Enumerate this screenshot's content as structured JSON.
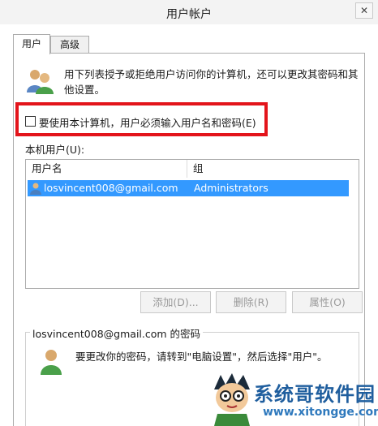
{
  "window": {
    "title": "用户帐户",
    "close_glyph": "✕"
  },
  "tabs": [
    {
      "label": "用户",
      "active": true
    },
    {
      "label": "高级",
      "active": false
    }
  ],
  "intro_text": "用下列表授予或拒绝用户访问你的计算机，还可以更改其密码和其他设置。",
  "require_login": {
    "label": "要使用本计算机，用户必须输入用户名和密码(E)",
    "checked": false
  },
  "highlight_color": "#e3141b",
  "local_users": {
    "label": "本机用户(U):",
    "columns": [
      "用户名",
      "组"
    ],
    "rows": [
      {
        "name": "losvincent008@gmail.com",
        "group": "Administrators",
        "selected": true
      }
    ],
    "selected_color": "#3399ff"
  },
  "buttons": {
    "add": "添加(D)...",
    "remove": "删除(R)",
    "properties": "属性(O)"
  },
  "password_group": {
    "legend": "losvincent008@gmail.com 的密码",
    "note": "要更改你的密码，请转到\"电脑设置\"，然后选择\"用户\"。"
  },
  "icons": {
    "users": "users-icon",
    "user": "user-icon",
    "row_user": "user-small-icon"
  },
  "watermark": {
    "title": "系统哥软件园",
    "url": "www.xitongge.com"
  }
}
